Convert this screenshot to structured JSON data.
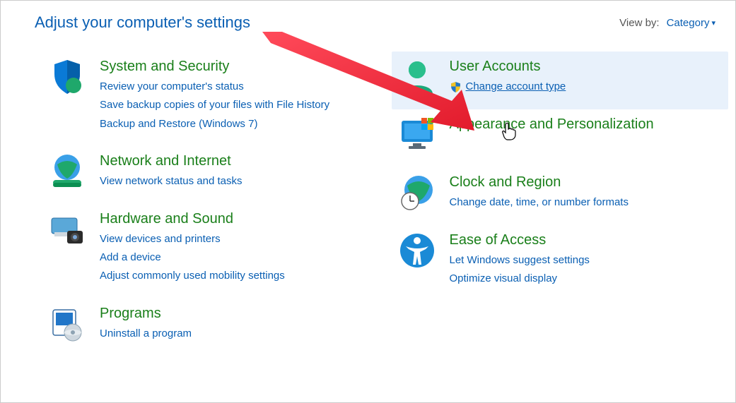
{
  "header": {
    "title": "Adjust your computer's settings",
    "view_by_label": "View by:",
    "view_by_value": "Category"
  },
  "left": {
    "system": {
      "title": "System and Security",
      "links": [
        "Review your computer's status",
        "Save backup copies of your files with File History",
        "Backup and Restore (Windows 7)"
      ]
    },
    "network": {
      "title": "Network and Internet",
      "links": [
        "View network status and tasks"
      ]
    },
    "hardware": {
      "title": "Hardware and Sound",
      "links": [
        "View devices and printers",
        "Add a device",
        "Adjust commonly used mobility settings"
      ]
    },
    "programs": {
      "title": "Programs",
      "links": [
        "Uninstall a program"
      ]
    }
  },
  "right": {
    "user": {
      "title": "User Accounts",
      "shield_link": "Change account type"
    },
    "appearance": {
      "title": "Appearance and Personalization"
    },
    "clock": {
      "title": "Clock and Region",
      "links": [
        "Change date, time, or number formats"
      ]
    },
    "ease": {
      "title": "Ease of Access",
      "links": [
        "Let Windows suggest settings",
        "Optimize visual display"
      ]
    }
  }
}
